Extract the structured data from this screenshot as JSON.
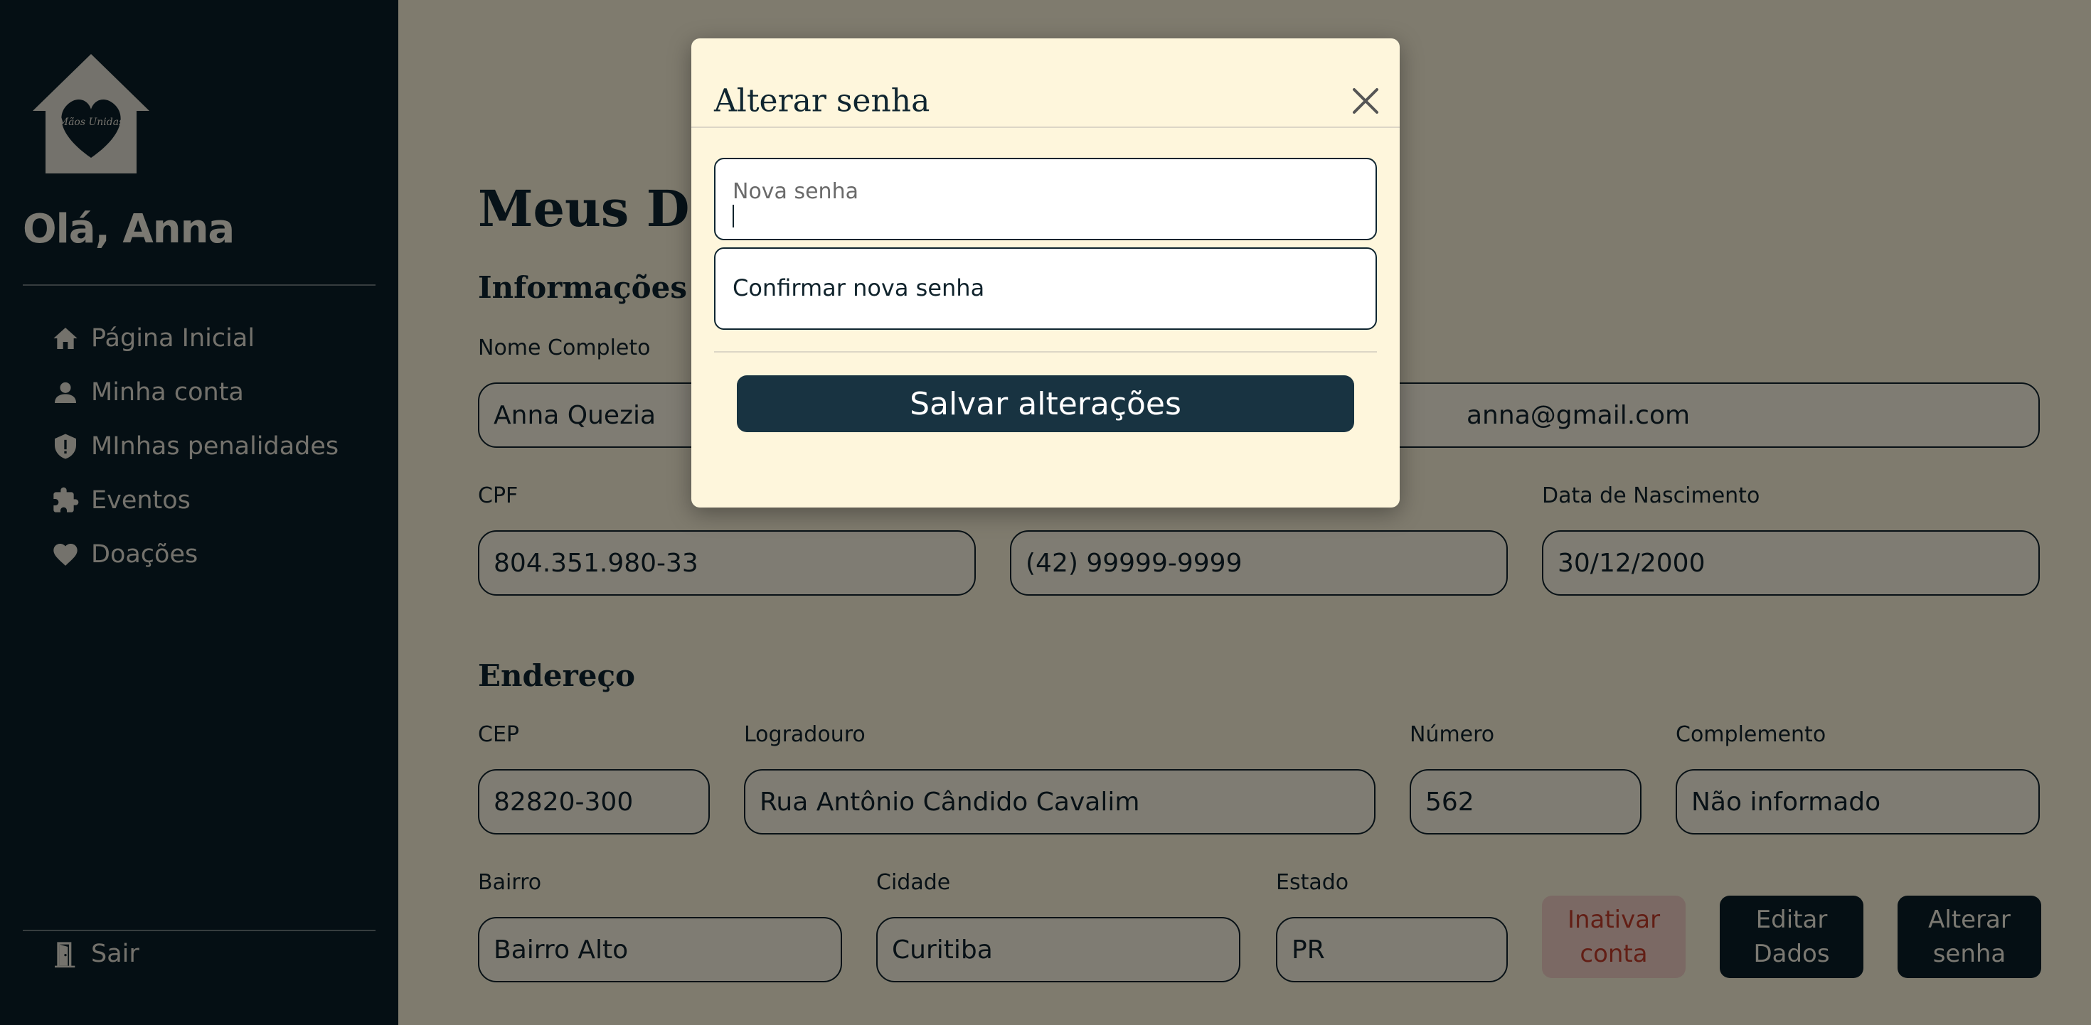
{
  "sidebar": {
    "greeting": "Olá, Anna",
    "logo_text": "Mãos Unidas",
    "items": [
      {
        "label": "Página Inicial",
        "icon": "home-icon"
      },
      {
        "label": "Minha conta",
        "icon": "user-icon"
      },
      {
        "label": "MInhas penalidades",
        "icon": "shield-alert-icon"
      },
      {
        "label": "Eventos",
        "icon": "puzzle-icon"
      },
      {
        "label": "Doações",
        "icon": "heart-icon"
      }
    ],
    "logout_label": "Sair",
    "logout_icon": "door-exit-icon"
  },
  "main": {
    "title": "Meus Dados",
    "personal_section": "Informações Pessoais",
    "address_section": "Endereço",
    "fields": {
      "full_name": {
        "label": "Nome Completo",
        "value": "Anna Quezia"
      },
      "email": {
        "label": "",
        "value": "anna@gmail.com"
      },
      "cpf": {
        "label": "CPF",
        "value": "804.351.980-33"
      },
      "phone": {
        "label": "",
        "value": "(42) 99999-9999"
      },
      "birth_date": {
        "label": "Data de Nascimento",
        "value": "30/12/2000"
      },
      "cep": {
        "label": "CEP",
        "value": "82820-300"
      },
      "street": {
        "label": "Logradouro",
        "value": "Rua Antônio Cândido Cavalim"
      },
      "number": {
        "label": "Número",
        "value": "562"
      },
      "complement": {
        "label": "Complemento",
        "value": "Não informado"
      },
      "district": {
        "label": "Bairro",
        "value": "Bairro Alto"
      },
      "city": {
        "label": "Cidade",
        "value": "Curitiba"
      },
      "state": {
        "label": "Estado",
        "value": "PR"
      }
    },
    "actions": {
      "deactivate": "Inativar conta",
      "edit": "Editar Dados",
      "change_password": "Alterar senha"
    }
  },
  "modal": {
    "title": "Alterar senha",
    "close_icon": "close-icon",
    "new_password": {
      "label": "Nova senha",
      "value": ""
    },
    "confirm_password": {
      "label": "Confirmar nova senha",
      "value": ""
    },
    "save_label": "Salvar alterações"
  },
  "colors": {
    "sidebar_bg": "#0B1E28",
    "page_bg": "#FEF6DC",
    "primary": "#183341",
    "danger_text": "#C43C2A",
    "danger_bg": "#F6D3C9"
  }
}
